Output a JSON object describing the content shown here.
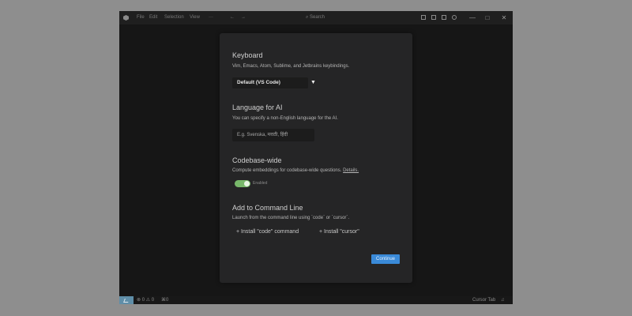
{
  "titlebar": {
    "menu": [
      "File",
      "Edit",
      "Selection",
      "View"
    ],
    "more": "···",
    "back": "←",
    "forward": "→",
    "search_placeholder": "Search"
  },
  "window_controls": {
    "minimize": "—",
    "maximize": "□",
    "close": "✕"
  },
  "modal": {
    "keyboard": {
      "title": "Keyboard",
      "description": "Vim, Emacs, Atom, Sublime, and Jetbrains keybindings.",
      "selected": "Default (VS Code)",
      "arrow": "▼"
    },
    "language": {
      "title": "Language for AI",
      "description": "You can specify a non-English language for the AI.",
      "placeholder": "E.g. Svenska, मराठी, हिंदी"
    },
    "codebase": {
      "title": "Codebase-wide",
      "description": "Compute embeddings for codebase-wide questions.",
      "details_link": "Details.",
      "toggle_label": "Enabled",
      "enabled": true
    },
    "cli": {
      "title": "Add to Command Line",
      "description": "Launch from the command line using `code` or `cursor`.",
      "install_code": "+ Install \"code\" command",
      "install_cursor": "+ Install \"cursor\""
    },
    "continue_label": "Continue"
  },
  "statusbar": {
    "errors": "0",
    "warnings": "0",
    "ports": "0",
    "right_text": "Cursor Tab"
  },
  "colors": {
    "window_bg": "#161616",
    "modal_bg": "#252526",
    "accent": "#3a8ad8",
    "toggle_on": "#78b86a",
    "remote_indicator": "#5f8ea8"
  }
}
